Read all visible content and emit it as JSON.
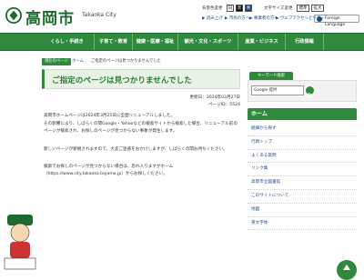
{
  "header": {
    "logo_text": "高岡市",
    "logo_sub": "Takaoka City",
    "util_links": [
      "背景色変更",
      "文字サイズ変更"
    ],
    "bg_buttons": [
      "白",
      "黒",
      "青"
    ],
    "size_buttons": [
      "標準",
      "拡大"
    ],
    "sub_links": [
      "▶ 読み上げ",
      "▶ 市民の方へ",
      "▶ 事業者の方へ",
      "▶ ウェブアクセシビリティ"
    ],
    "language_label": "Foreign Language"
  },
  "nav": {
    "items": [
      "くらし・手続き",
      "子育て・教育",
      "健康・医療・福祉",
      "観光・文化・スポーツ",
      "産業・ビジネス",
      "行政情報"
    ]
  },
  "breadcrumb": {
    "current_badge": "現在のページ",
    "home": "ホーム",
    "current": "ご指定のページは見つかりませんでした"
  },
  "page": {
    "title": "ご指定のページは見つかりませんでした",
    "updated": "更新日：2024年03月27日",
    "page_id": "ページID：5524",
    "paragraphs": [
      "高岡市ホームページは2024年3月25日に全面リニューアルしました。",
      "その影響により、しばらくの間Google・Yahooなどの検索サイトから検索した場合、リニューアル前のページが検索され、お探しのページが見つからない事象が発生します。",
      "新しいページが新規されますので、大変ご迷惑をおかけしますが、しばらくの間お待ちください。",
      "検索でお探しのページが見つからない場合は、恐れ入りますがホーム（https://www.city.takaoka.toyama.jp）からお探しください。"
    ]
  },
  "sidebar": {
    "search_tab": "キーワード検索",
    "search_placeholder": "Google 提供",
    "home_label": "ホーム",
    "items": [
      "組織から探す",
      "行政トップ",
      "よくある質問",
      "リンク集",
      "高岡市立図書館",
      "このサイトについて",
      "地図",
      "英文字体"
    ]
  },
  "colors": {
    "brand_green": "#2f8a3e",
    "dark_green": "#1d6a2f",
    "link_blue": "#1a4c8c"
  }
}
